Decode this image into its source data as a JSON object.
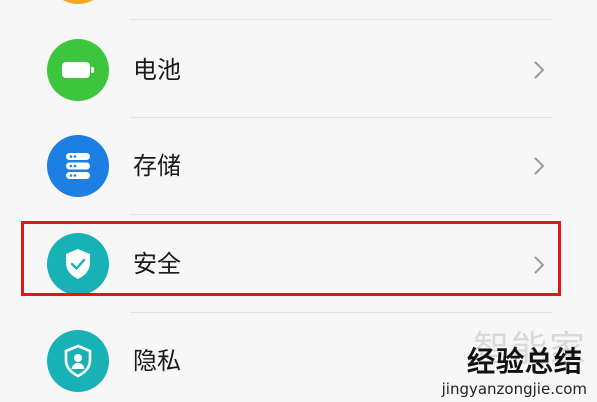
{
  "settings_list": {
    "items": [
      {
        "label": "电池",
        "icon": "battery-icon",
        "icon_color": "#3ec53e"
      },
      {
        "label": "存储",
        "icon": "storage-icon",
        "icon_color": "#1d7fe3"
      },
      {
        "label": "安全",
        "icon": "shield-check-icon",
        "icon_color": "#18b2b6",
        "highlighted": true
      },
      {
        "label": "隐私",
        "icon": "privacy-user-shield-icon",
        "icon_color": "#18b2b6"
      }
    ],
    "top_partial_icon_color": "#f5a623",
    "highlight_color": "#e3171a"
  },
  "watermark": {
    "ghost": "智能家",
    "main": "经验总结",
    "url": "jingyanzongjie.com"
  }
}
